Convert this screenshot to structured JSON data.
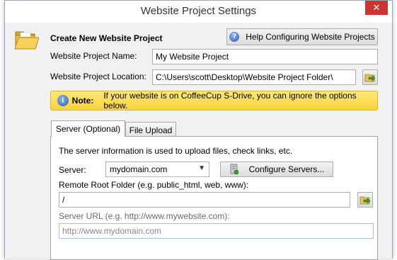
{
  "window": {
    "title": "Website Project Settings",
    "close_label": "✕"
  },
  "header": {
    "title": "Create New Website Project",
    "help_button": "Help Configuring Website Projects",
    "folder_icon": "folder-icon"
  },
  "form": {
    "name_label": "Website Project Name:",
    "name_value": "My Website Project",
    "location_label": "Website Project Location:",
    "location_value": "C:\\Users\\scott\\Desktop\\Website Project Folder\\"
  },
  "note": {
    "label": "Note:",
    "text": "If your website is on CoffeeCup S-Drive, you can ignore the options below.",
    "icon": "info-icon",
    "color": "#f8d33b"
  },
  "tabs": [
    {
      "label": "Server (Optional)",
      "active": true
    },
    {
      "label": "File Upload",
      "active": false
    }
  ],
  "server_tab": {
    "description": "The server information is used to upload files, check links, etc.",
    "server_label": "Server:",
    "server_selected": "mydomain.com",
    "configure_button": "Configure Servers...",
    "remote_root_label": "Remote Root Folder (e.g. public_html, web, www):",
    "remote_root_value": "/",
    "server_url_label": "Server URL (e.g. http://www.mywebsite.com):",
    "server_url_placeholder": "http://www.mydomain.com"
  }
}
